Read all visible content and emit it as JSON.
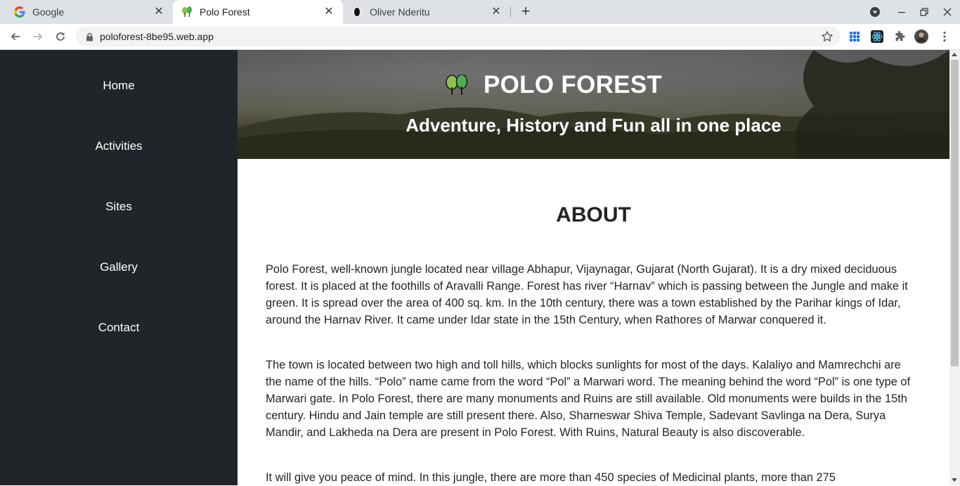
{
  "browser": {
    "tabs": [
      {
        "title": "Google",
        "favicon": "google-g-icon"
      },
      {
        "title": "Polo Forest",
        "favicon": "trees-icon"
      },
      {
        "title": "Oliver Nderitu",
        "favicon": "profile-silhouette-icon"
      }
    ],
    "active_tab": 1,
    "url": "poloforest-8be95.web.app",
    "colors": {
      "tabstrip": "#dee1e6",
      "omnibox": "#f1f3f4"
    }
  },
  "sidebar": {
    "items": [
      {
        "label": "Home"
      },
      {
        "label": "Activities"
      },
      {
        "label": "Sites"
      },
      {
        "label": "Gallery"
      },
      {
        "label": "Contact"
      }
    ],
    "background": "#212529"
  },
  "hero": {
    "logo": "trees-icon",
    "title": "POLO FOREST",
    "subtitle": "Adventure, History and Fun all in one place"
  },
  "about": {
    "heading": "ABOUT",
    "paragraphs": [
      "Polo Forest, well-known jungle located near village Abhapur, Vijaynagar, Gujarat (North Gujarat). It is a dry mixed deciduous forest. It is placed at the foothills of Aravalli Range. Forest has river “Harnav” which is passing between the Jungle and make it green. It is spread over the area of 400 sq. km. In the 10th century, there was a town established by the Parihar kings of Idar, around the Harnav River. It came under Idar state in the 15th Century, when Rathores of Marwar conquered it.",
      "The town is located between two high and toll hills, which blocks sunlights for most of the days. Kalaliyo and Mamrechchi are the name of the hills. “Polo” name came from the word “Pol” a Marwari word. The meaning behind the word “Pol” is one type of Marwari gate. In Polo Forest, there are many monuments and Ruins are still available. Old monuments were builds in the 15th century. Hindu and Jain temple are still present there. Also, Sharneswar Shiva Temple, Sadevant Savlinga na Dera, Surya Mandir, and Lakheda na Dera are present in Polo Forest. With Ruins, Natural Beauty is also discoverable.",
      "It will give you peace of mind. In this jungle, there are more than 450 species of Medicinal plants, more than 275"
    ]
  }
}
